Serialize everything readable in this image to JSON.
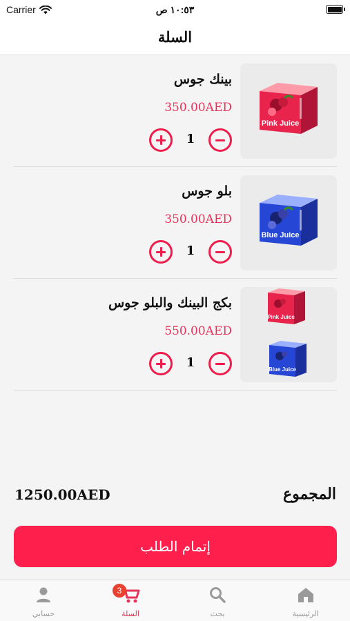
{
  "status_bar": {
    "carrier": "Carrier",
    "time": "١٠:٥٣ ص"
  },
  "header": {
    "title": "السلة"
  },
  "cart": {
    "items": [
      {
        "name": "بينك جوس",
        "price": "350.00AED",
        "quantity": "1",
        "image_labels": [
          "Pink Juice"
        ]
      },
      {
        "name": "بلو جوس",
        "price": "350.00AED",
        "quantity": "1",
        "image_labels": [
          "Blue Juice"
        ]
      },
      {
        "name": "بكج البينك والبلو جوس",
        "price": "550.00AED",
        "quantity": "1",
        "image_labels": [
          "Pink Juice",
          "Blue Juice"
        ]
      }
    ]
  },
  "summary": {
    "total_label": "المجموع",
    "total_value": "1250.00AED"
  },
  "checkout": {
    "label": "إتمام الطلب"
  },
  "tab_bar": {
    "tabs": [
      {
        "label": "حسابي",
        "icon": "person-icon"
      },
      {
        "label": "السلة",
        "icon": "cart-icon",
        "badge": "3",
        "active": true
      },
      {
        "label": "بحث",
        "icon": "search-icon"
      },
      {
        "label": "الرئيسية",
        "icon": "home-icon"
      }
    ]
  },
  "colors": {
    "accent": "#ff1f4d",
    "price": "#e8345a",
    "pink_box": "#e8244d",
    "blue_box": "#2647d6"
  }
}
